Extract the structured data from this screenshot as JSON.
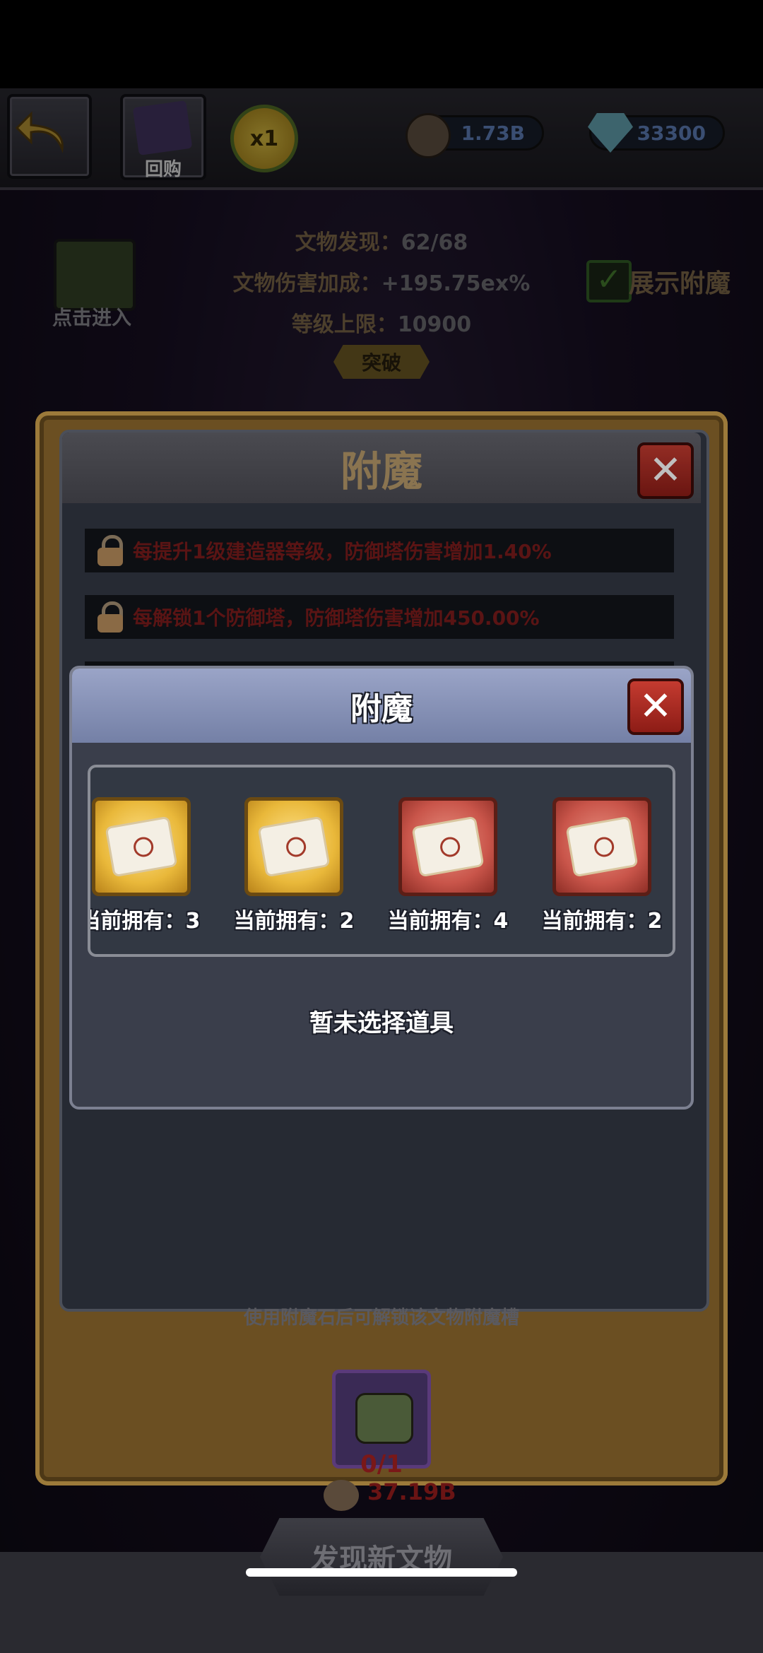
{
  "topbar": {
    "buyback_label": "回购",
    "speed_label": "x1",
    "gold_amount": "1.73B",
    "gem_amount": "33300"
  },
  "relic_stats": {
    "discovered_label": "文物发现：",
    "discovered_value": "62/68",
    "damage_bonus_label": "文物伤害加成：",
    "damage_bonus_value": "+195.75ex%",
    "level_cap_label": "等级上限：",
    "level_cap_value": "10900",
    "breakthrough_label": "突破",
    "enter_label": "点击进入",
    "show_enchant_label": "展示附魔",
    "show_enchant_checked": true
  },
  "outer_modal": {
    "title": "附魔",
    "locked_rows": [
      "每提升1级建造器等级，防御塔伤害增加1.40%",
      "每解锁1个防御塔，防御塔伤害增加450.00%"
    ],
    "hint_text": "使用附魔石后可解锁该文物附魔槽",
    "slot_progress": "0/1",
    "cost_value": "37.19B"
  },
  "inner_modal": {
    "title": "附魔",
    "items": [
      {
        "count_label": "当前拥有：3",
        "rarity": "gold"
      },
      {
        "count_label": "当前拥有：2",
        "rarity": "gold"
      },
      {
        "count_label": "当前拥有：4",
        "rarity": "red"
      },
      {
        "count_label": "当前拥有：2",
        "rarity": "red"
      }
    ],
    "empty_selection_text": "暂未选择道具"
  },
  "bottom": {
    "discover_button_label": "发现新文物"
  },
  "colors": {
    "gold_accent": "#8a7450",
    "close_red": "#c43b30",
    "inner_header": "#8a93b8"
  }
}
